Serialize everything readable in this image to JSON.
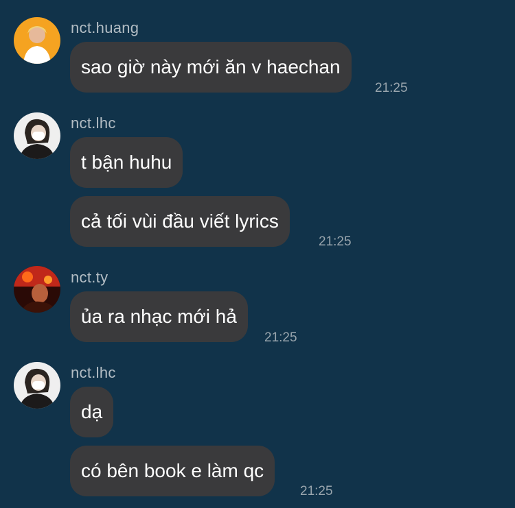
{
  "messages": [
    {
      "sender": "nct.huang",
      "avatar": "person-avatar-icon",
      "bubbles": [
        "sao giờ này mới ăn v haechan"
      ],
      "time": "21:25"
    },
    {
      "sender": "nct.lhc",
      "avatar": "person-avatar-icon",
      "bubbles": [
        "t bận huhu",
        "cả tối vùi đầu viết lyrics"
      ],
      "time": "21:25"
    },
    {
      "sender": "nct.ty",
      "avatar": "person-avatar-icon",
      "bubbles": [
        "ủa ra nhạc mới hả"
      ],
      "time": "21:25"
    },
    {
      "sender": "nct.lhc",
      "avatar": "person-avatar-icon",
      "bubbles": [
        "dạ",
        "có bên book e làm qc"
      ],
      "time": "21:25"
    }
  ],
  "colors": {
    "background": "#11334a",
    "bubble": "#3a3a3c",
    "text": "#ffffff",
    "sender": "#b3bdc4",
    "timestamp": "#99a5ad"
  }
}
